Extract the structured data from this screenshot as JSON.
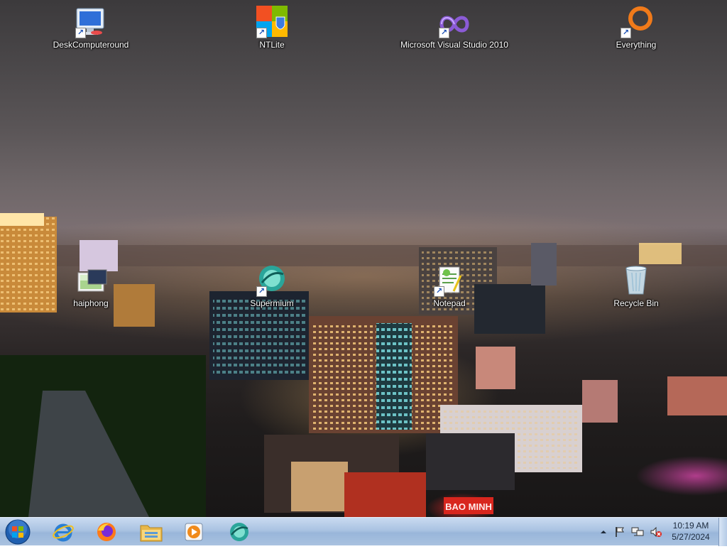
{
  "desktop": {
    "icons": [
      {
        "label": "DeskComputeround",
        "icon": "computer-icon"
      },
      {
        "label": "NTLite",
        "icon": "ntlite-icon"
      },
      {
        "label": "Microsoft Visual Studio 2010",
        "icon": "visual-studio-icon"
      },
      {
        "label": "Everything",
        "icon": "everything-icon"
      },
      {
        "label": "haiphong",
        "icon": "image-file-icon"
      },
      {
        "label": "Supermium",
        "icon": "supermium-icon"
      },
      {
        "label": "Notepad",
        "icon": "notepad-icon"
      },
      {
        "label": "Recycle Bin",
        "icon": "recycle-bin-icon"
      }
    ],
    "billboard_text": "BAO MINH"
  },
  "taskbar": {
    "pinned": [
      {
        "name": "Internet Explorer",
        "icon": "internet-explorer-icon"
      },
      {
        "name": "Firefox",
        "icon": "firefox-icon"
      },
      {
        "name": "Windows Explorer",
        "icon": "folder-icon"
      },
      {
        "name": "Media Player",
        "icon": "media-player-icon"
      },
      {
        "name": "Supermium",
        "icon": "supermium-icon"
      }
    ],
    "tray": {
      "icons": [
        "chevron-up-icon",
        "flag-icon",
        "network-icon",
        "volume-muted-icon"
      ]
    },
    "clock": {
      "time": "10:19 AM",
      "date": "5/27/2024"
    }
  },
  "colors": {
    "taskbar": "#aac3e2",
    "label_text": "#ffffff",
    "everything_orange": "#f07a1a"
  }
}
